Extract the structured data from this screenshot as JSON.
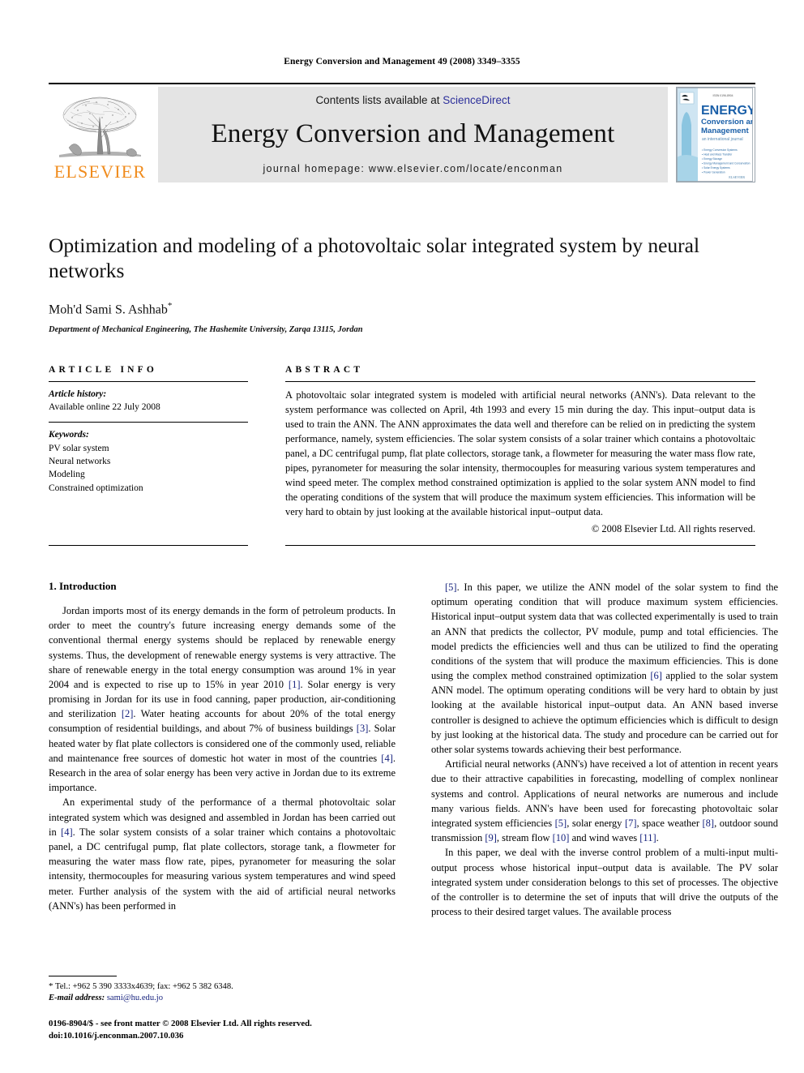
{
  "running_head": "Energy Conversion and Management 49 (2008) 3349–3355",
  "masthead": {
    "publisher_name": "ELSEVIER",
    "contents_prefix": "Contents lists available at ",
    "contents_link": "ScienceDirect",
    "journal_name": "Energy Conversion and Management",
    "homepage_line": "journal homepage: www.elsevier.com/locate/enconman",
    "cover": {
      "title_line1": "ENERGY",
      "title_line2": "Conversion and",
      "title_line3": "Management",
      "subtitle": "an international journal"
    }
  },
  "article": {
    "title": "Optimization and modeling of a photovoltaic solar integrated system by neural networks",
    "author": "Moh'd Sami S. Ashhab",
    "author_marker": "*",
    "affiliation": "Department of Mechanical Engineering, The Hashemite University, Zarqa 13115, Jordan"
  },
  "info": {
    "label": "ARTICLE INFO",
    "history_title": "Article history:",
    "history_value": "Available online 22 July 2008",
    "keywords_title": "Keywords:",
    "keywords": [
      "PV solar system",
      "Neural networks",
      "Modeling",
      "Constrained optimization"
    ]
  },
  "abstract": {
    "label": "ABSTRACT",
    "text": "A photovoltaic solar integrated system is modeled with artificial neural networks (ANN's). Data relevant to the system performance was collected on April, 4th 1993 and every 15 min during the day. This input–output data is used to train the ANN. The ANN approximates the data well and therefore can be relied on in predicting the system performance, namely, system efficiencies. The solar system consists of a solar trainer which contains a photovoltaic panel, a DC centrifugal pump, flat plate collectors, storage tank, a flowmeter for measuring the water mass flow rate, pipes, pyranometer for measuring the solar intensity, thermocouples for measuring various system temperatures and wind speed meter. The complex method constrained optimization is applied to the solar system ANN model to find the operating conditions of the system that will produce the maximum system efficiencies. This information will be very hard to obtain by just looking at the available historical input–output data.",
    "copyright": "© 2008 Elsevier Ltd. All rights reserved."
  },
  "body": {
    "section_heading": "1. Introduction",
    "left_paragraphs": [
      "Jordan imports most of its energy demands in the form of petroleum products. In order to meet the country's future increasing energy demands some of the conventional thermal energy systems should be replaced by renewable energy systems. Thus, the development of renewable energy systems is very attractive. The share of renewable energy in the total energy consumption was around 1% in year 2004 and is expected to rise up to 15% in year 2010 [1]. Solar energy is very promising in Jordan for its use in food canning, paper production, air-conditioning and sterilization [2]. Water heating accounts for about 20% of the total energy consumption of residential buildings, and about 7% of business buildings [3]. Solar heated water by flat plate collectors is considered one of the commonly used, reliable and maintenance free sources of domestic hot water in most of the countries [4]. Research in the area of solar energy has been very active in Jordan due to its extreme importance.",
      "An experimental study of the performance of a thermal photovoltaic solar integrated system which was designed and assembled in Jordan has been carried out in [4]. The solar system consists of a solar trainer which contains a photovoltaic panel, a DC centrifugal pump, flat plate collectors, storage tank, a flowmeter for measuring the water mass flow rate, pipes, pyranometer for measuring the solar intensity, thermocouples for measuring various system temperatures and wind speed meter. Further analysis of the system with the aid of artificial neural networks (ANN's) has been performed in"
    ],
    "right_paragraphs": [
      "[5]. In this paper, we utilize the ANN model of the solar system to find the optimum operating condition that will produce maximum system efficiencies. Historical input–output system data that was collected experimentally is used to train an ANN that predicts the collector, PV module, pump and total efficiencies. The model predicts the efficiencies well and thus can be utilized to find the operating conditions of the system that will produce the maximum efficiencies. This is done using the complex method constrained optimization [6] applied to the solar system ANN model. The optimum operating conditions will be very hard to obtain by just looking at the available historical input–output data. An ANN based inverse controller is designed to achieve the optimum efficiencies which is difficult to design by just looking at the historical data. The study and procedure can be carried out for other solar systems towards achieving their best performance.",
      "Artificial neural networks (ANN's) have received a lot of attention in recent years due to their attractive capabilities in forecasting, modelling of complex nonlinear systems and control. Applications of neural networks are numerous and include many various fields. ANN's have been used for forecasting photovoltaic solar integrated system efficiencies [5], solar energy [7], space weather [8], outdoor sound transmission [9], stream flow [10] and wind waves [11].",
      "In this paper, we deal with the inverse control problem of a multi-input multi-output process whose historical input–output data is available. The PV solar integrated system under consideration belongs to this set of processes. The objective of the controller is to determine the set of inputs that will drive the outputs of the process to their desired target values. The available process"
    ]
  },
  "footnote": {
    "marker": "*",
    "contact": "Tel.: +962 5 390 3333x4639; fax: +962 5 382 6348.",
    "email_label": "E-mail address:",
    "email": "sami@hu.edu.jo"
  },
  "footer": {
    "issn_line": "0196-8904/$ - see front matter © 2008 Elsevier Ltd. All rights reserved.",
    "doi_line": "doi:10.1016/j.enconman.2007.10.036"
  },
  "colors": {
    "link": "#17237e",
    "sciencedirect": "#2c2f9b",
    "elsevier_orange": "#F08C1E",
    "masthead_gray": "#e4e4e4"
  }
}
